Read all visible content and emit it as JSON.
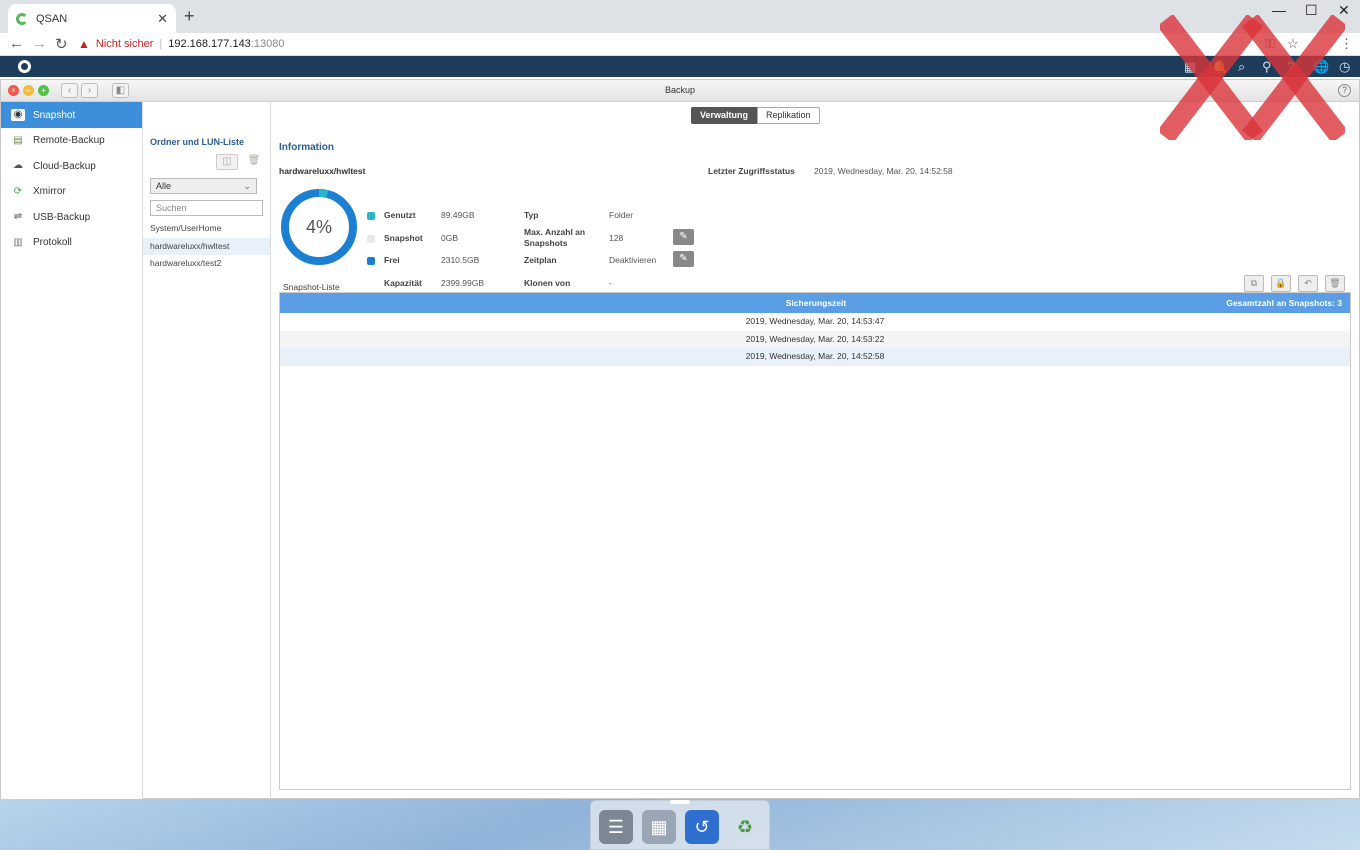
{
  "browser": {
    "tab_title": "QSAN",
    "security_label": "Nicht sicher",
    "url_host": "192.168.177.143",
    "url_port": ":13080"
  },
  "window": {
    "title": "Backup"
  },
  "sidebar": {
    "items": [
      {
        "label": "Snapshot",
        "icon": "camera-icon"
      },
      {
        "label": "Remote-Backup",
        "icon": "remote-backup-icon"
      },
      {
        "label": "Cloud-Backup",
        "icon": "cloud-icon"
      },
      {
        "label": "Xmirror",
        "icon": "sync-icon"
      },
      {
        "label": "USB-Backup",
        "icon": "usb-icon"
      },
      {
        "label": "Protokoll",
        "icon": "log-icon"
      }
    ]
  },
  "folders": {
    "heading": "Ordner und LUN-Liste",
    "filter": "Alle",
    "search_placeholder": "Suchen",
    "items": [
      "System/UserHome",
      "hardwareluxx/hwltest",
      "hardwareluxx/test2"
    ]
  },
  "tabs": [
    "Verwaltung",
    "Replikation"
  ],
  "info": {
    "heading": "Information",
    "volume": "hardwareluxx/hwltest",
    "percent": "4%",
    "used_fraction": 0.04,
    "colors": {
      "used": "#27b6c9",
      "snapshot": "#e8e8e8",
      "free": "#1d7fd1"
    },
    "last_access_label": "Letzter Zugriffsstatus",
    "last_access_value": "2019, Wednesday, Mar. 20, 14:52:58",
    "used_label": "Genutzt",
    "used_value": "89.49GB",
    "snapshot_label": "Snapshot",
    "snapshot_value": "0GB",
    "free_label": "Frei",
    "free_value": "2310.5GB",
    "capacity_label": "Kapazität",
    "capacity_value": "2399.99GB",
    "type_label": "Typ",
    "type_value": "Folder",
    "max_label_1": "Max. Anzahl an",
    "max_label_2": "Snapshots",
    "max_value": "128",
    "schedule_label": "Zeitplan",
    "schedule_value": "Deaktivieren",
    "clone_label": "Klonen von",
    "clone_value": "-"
  },
  "snapshots": {
    "label": "Snapshot-Liste",
    "col_time": "Sicherungszeit",
    "col_total": "Gesamtzahl an Snapshots: 3",
    "rows": [
      "2019, Wednesday, Mar. 20, 14:53:47",
      "2019, Wednesday, Mar. 20, 14:53:22",
      "2019, Wednesday, Mar. 20, 14:52:58"
    ]
  }
}
